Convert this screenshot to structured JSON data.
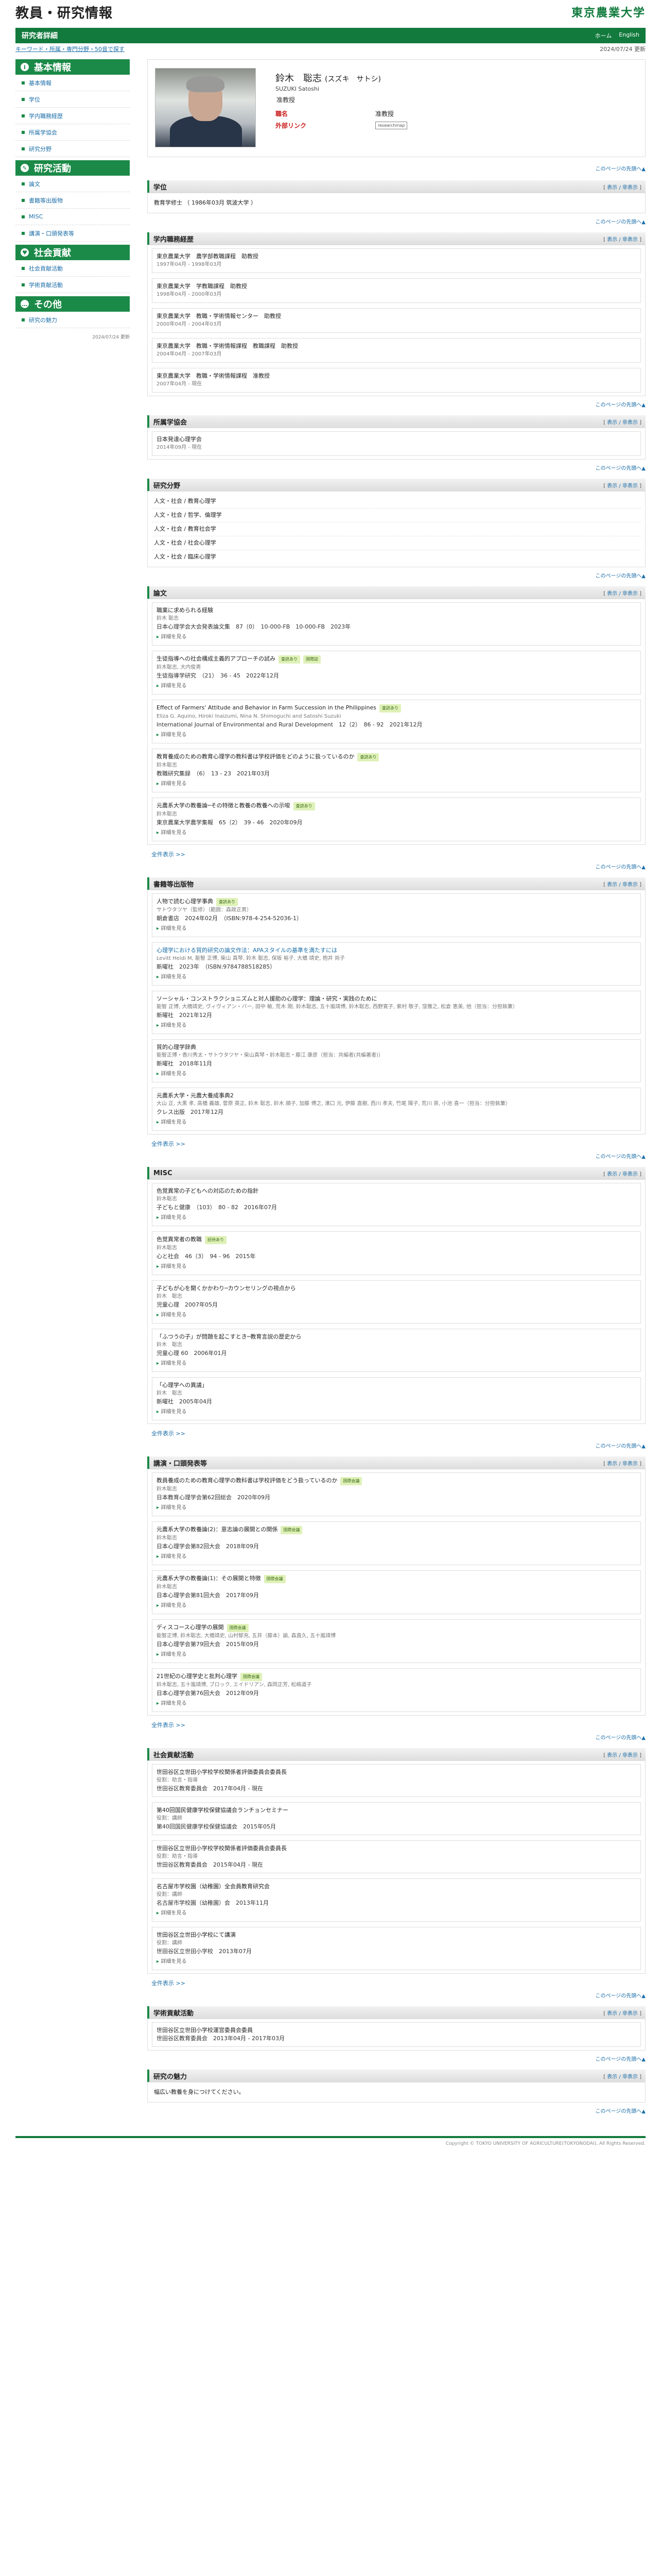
{
  "header": {
    "site_title": "教員・研究情報",
    "logo": "東京農業大学",
    "page_label": "研究者詳細",
    "links": [
      "ホーム",
      "English"
    ]
  },
  "breadcrumb": "キーワード・所属・専門分野・50音で探す",
  "updated": "2024/07/24 更新",
  "sidebar": {
    "groups": [
      {
        "title": "基本情報",
        "items": [
          "基本情報",
          "学位",
          "学内職務経歴",
          "所属学協会",
          "研究分野"
        ]
      },
      {
        "title": "研究活動",
        "items": [
          "論文",
          "書籍等出版物",
          "MISC",
          "講演・口頭発表等"
        ]
      },
      {
        "title": "社会貢献",
        "items": [
          "社会貢献活動",
          "学術貢献活動"
        ]
      },
      {
        "title": "その他",
        "items": [
          "研究の魅力"
        ]
      }
    ],
    "date": "2024/07/24 更新"
  },
  "profile": {
    "name": "鈴木　聡志",
    "kana": "(スズキ　サトシ)",
    "romaji": "SUZUKI Satoshi",
    "rank": "准教授",
    "label_affil": "職名",
    "affil": "准教授",
    "label_ext": "外部リンク",
    "ext": "",
    "badge": "researchmap"
  },
  "pagetop": "このページの先頭へ▲",
  "ctl": {
    "show": "表示",
    "sep": " / ",
    "hide": "非表示"
  },
  "sections": {
    "degree": {
      "title": "学位",
      "items": [
        "教育学修士 （ 1986年03月   筑波大学 ）"
      ]
    },
    "career": {
      "title": "学内職務経歴",
      "items": [
        {
          "t": "東京農業大学　農学部教職課程　助教授",
          "d": "1997年04月 - 1998年03月"
        },
        {
          "t": "東京農業大学　学教職課程　助教授",
          "d": "1998年04月 - 2000年03月"
        },
        {
          "t": "東京農業大学　教職・学術情報センター　助教授",
          "d": "2000年04月 - 2004年03月"
        },
        {
          "t": "東京農業大学　教職・学術情報課程　教職課程　助教授",
          "d": "2004年04月 - 2007年03月"
        },
        {
          "t": "東京農業大学　教職・学術情報課程　准教授",
          "d": "2007年04月 - 現在"
        }
      ]
    },
    "society": {
      "title": "所属学協会",
      "items": [
        {
          "t": "日本発達心理学会",
          "d": "2014年09月 - 現在"
        }
      ]
    },
    "field": {
      "title": "研究分野",
      "items": [
        "人文・社会 / 教育心理学",
        "人文・社会 / 哲学、倫理学",
        "人文・社会 / 教育社会学",
        "人文・社会 / 社会心理学",
        "人文・社会 / 臨床心理学"
      ]
    },
    "papers": {
      "title": "論文",
      "all": "全件表示 >>",
      "items": [
        {
          "t": "職業に求められる経験",
          "tag": "",
          "a": "鈴木 聡志",
          "m": "日本心理学会大会発表論文集　87（0）　10-000-FB　10-000-FB　2023年",
          "more": "詳細を見る"
        },
        {
          "t": "生徒指導への社会構成主義的アプローチの試み",
          "tag": "査読あり",
          "tag2": "国際誌",
          "a": "鈴木聡志, 大内俊男",
          "m": "生徒指導学研究　（21）　36 - 45　2022年12月",
          "more": "詳細を見る"
        },
        {
          "t": "Effect of Farmers' Attitude and Behavior in Farm Succession in the Philippines",
          "tag": "査読あり",
          "a": "Eliza G. Aquino, Hiroki Inaizumi, Nina N. Shimoguchi and Satoshi Suzuki",
          "m": "International Journal of Environmental and Rural Development　12（2）　86 - 92　2021年12月",
          "more": "詳細を見る"
        },
        {
          "t": "教育養成のための教育心理学の教科書は学校評価をどのように扱っているのか",
          "tag": "査読あり",
          "a": "鈴木聡志",
          "m": "教職研究集録　（6）　13 - 23　2021年03月",
          "more": "詳細を見る"
        },
        {
          "t": "元農系大学の教養論─その特徴と教養の教養への示唆",
          "tag": "査読あり",
          "a": "鈴木聡志",
          "m": "東京農業大学農学集報　65（2）　39 - 46　2020年09月",
          "more": "詳細を見る"
        }
      ]
    },
    "books": {
      "title": "書籍等出版物",
      "all": "全件表示 >>",
      "items": [
        {
          "t": "人物で読む心理学事典",
          "tag": "査読あり",
          "a": "サトウタツヤ（監修）（範囲：森政正男）",
          "m": "朝倉書店　2024年02月　（ISBN:978-4-254-52036-1）",
          "more": "詳細を見る",
          "lk": false
        },
        {
          "t": "心理学における質的研究の論文作法：APAスタイルの基準を満たすには",
          "tag": "",
          "a": "Levitt Heidi M, 能智 正博, 柴山 真琴, 鈴木 聡志, 保坂 裕子, 大橋 靖史, 抱井 尚子",
          "m": "新曜社　2023年　（ISBN:9784788518285）",
          "more": "詳細を見る",
          "lk": true
        },
        {
          "t": "ソーシャル・コンストラクショニズムと対人援助の心理学：理論・研究・実践のために",
          "tag": "",
          "a": "能智 正博, 大橋靖史, ヴィヴィアン・バー, 田中 敏, 荒木 剛, 鈴木聡志, 五十嵐靖博, 鈴木聡志, 西野寛子, 紫村 敬子, 窪雅之, 松倉 恵美, 他（担当：分担執筆）",
          "m": "新曜社　2021年12月",
          "more": "詳細を見る",
          "lk": false
        },
        {
          "t": "質的心理学辞典",
          "tag": "",
          "a": "能智正博・香川秀太・サトウタツヤ・柴山真琴・鈴木聡志・藤江 康彦（担当：共編者(共編著者)）",
          "m": "新曜社　2018年11月",
          "more": "詳細を見る",
          "lk": false
        },
        {
          "t": "元農系大学・元農大養成事典2",
          "tag": "",
          "a": "大山 正, 大黒 孝, 高橋 義雄, 菅原 英正, 鈴木 聡志, 鈴木 順子, 加藤 博之, 濱口 元, 伊藤 直樹, 西川 孝夫, 竹尾 陽子, 荒川 崇, 小池 喜一（担当：分担執筆）",
          "m": "クレス出版　2017年12月",
          "more": "詳細を見る",
          "lk": false
        }
      ]
    },
    "misc": {
      "title": "MISC",
      "all": "全件表示 >>",
      "items": [
        {
          "t": "色覚異常の子どもへの対応のための指針",
          "tag": "",
          "a": "鈴木聡志",
          "m": "子どもと健康　（103）　80 - 82　2016年07月",
          "more": "詳細を見る"
        },
        {
          "t": "色覚異常者の教職",
          "tag": "招待あり",
          "a": "鈴木聡志",
          "m": "心と社会　46（3）　94 - 96　2015年",
          "more": "詳細を見る"
        },
        {
          "t": "子どもが心を開くかかわり─カウンセリングの視点から",
          "tag": "",
          "a": "鈴木　聡志",
          "m": "児童心理　2007年05月",
          "more": "詳細を見る"
        },
        {
          "t": "「ふつうの子」が問題を起こすとき─教育言説の歴史から",
          "tag": "",
          "a": "鈴木　聡志",
          "m": "児童心理 60　2006年01月",
          "more": "詳細を見る"
        },
        {
          "t": "「心理学への異議」",
          "tag": "",
          "a": "鈴木　聡志",
          "m": "新曜社　2005年04月",
          "more": "詳細を見る"
        }
      ]
    },
    "talks": {
      "title": "講演・口頭発表等",
      "all": "全件表示 >>",
      "items": [
        {
          "t": "教員養成のための教育心理学の教科書は学校評価をどう扱っているのか",
          "tag": "国際会議",
          "a": "鈴木聡志",
          "m": "日本教育心理学会第62回総会　2020年09月",
          "more": "詳細を見る"
        },
        {
          "t": "元農系大学の教養論(2)：意志論の展開との関係",
          "tag": "国際会議",
          "a": "鈴木聡志",
          "m": "日本心理学会第82回大会　2018年09月",
          "more": "詳細を見る"
        },
        {
          "t": "元農系大学の教養論(1)：その展開と特徴",
          "tag": "国際会議",
          "a": "鈴木聡志",
          "m": "日本心理学会第81回大会　2017年09月",
          "more": "詳細を見る"
        },
        {
          "t": "ディスコース心理学の展開",
          "tag": "国際会議",
          "a": "能智正博, 鈴木聡志, 大橋靖史, 山村郁充, 五井（藤本）諭, 森直久, 五十嵐靖博",
          "m": "日本心理学会第79回大会　2015年09月",
          "more": "詳細を見る"
        },
        {
          "t": "21世紀の心理学史と批判心理学",
          "tag": "国際会議",
          "a": "鈴木聡志, 五十嵐靖博, ブロック, エイドリアン, 森岡正芳, 松嶋道子",
          "m": "日本心理学会第76回大会　2012年09月",
          "more": "詳細を見る"
        }
      ]
    },
    "social": {
      "title": "社会貢献活動",
      "all": "全件表示 >>",
      "items": [
        {
          "t": "世田谷区立世田小学校学校関係者評価委員会委員長",
          "r": "役割：助言・指導",
          "o": "世田谷区教育委員会　2017年04月 - 現在"
        },
        {
          "t": "第40回国民健康学校保健協議会ランチョンセミナー",
          "r": "役割：講師",
          "o": "第40回国民健康学校保健協議会　2015年05月"
        },
        {
          "t": "世田谷区立世田小学校学校関係者評価委員会委員長",
          "r": "役割：助言・指導",
          "o": "世田谷区教育委員会　2015年04月 - 現在"
        },
        {
          "t": "名古屋市学校園（幼稚園）全会員教育研究会",
          "r": "役割：講師",
          "o": "名古屋市学校園（幼稚園）会　2013年11月",
          "more": "詳細を見る"
        },
        {
          "t": "世田谷区立世田小学校にて講演",
          "r": "役割：講師",
          "o": "世田谷区立世田小学校　2013年07月",
          "more": "詳細を見る"
        }
      ]
    },
    "academic": {
      "title": "学術貢献活動",
      "items": [
        {
          "t": "世田谷区立世田小学校運営委員会委員",
          "o": "世田谷区教育委員会　2013年04月 - 2017年03月"
        }
      ]
    },
    "charm": {
      "title": "研究の魅力",
      "items": [
        "幅広い教養を身につけてください。"
      ]
    }
  },
  "footer": "Copyright © TOKYO UNIVERSITY OF AGRICULTURE(TOKYONODAI), All Rights Reserved."
}
